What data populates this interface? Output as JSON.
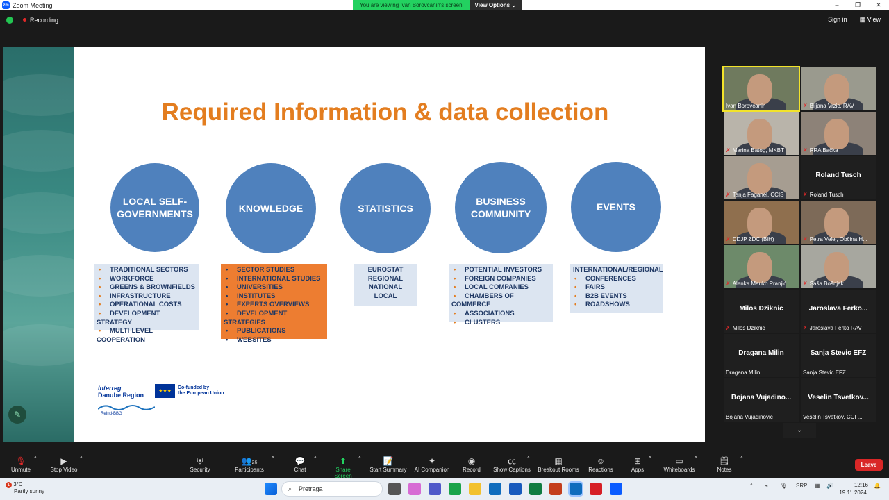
{
  "window": {
    "title": "Zoom Meeting"
  },
  "banner": {
    "message": "You are viewing Ivan Borovcanin's screen",
    "options_label": "View Options"
  },
  "window_controls": {
    "minimize": "–",
    "restore": "❐",
    "close": "✕"
  },
  "topbar": {
    "recording_label": "Recording",
    "sign_in": "Sign in",
    "view": "View"
  },
  "slide": {
    "title": "Required Information & data collection",
    "circles": [
      "LOCAL SELF-GOVERNMENTS",
      "KNOWLEDGE",
      "STATISTICS",
      "BUSINESS COMMUNITY",
      "EVENTS"
    ],
    "lists": {
      "local": [
        "TRADITIONAL SECTORS",
        "WORKFORCE",
        "GREENS & BROWNFIELDS",
        "INFRASTRUCTURE",
        "OPERATIONAL COSTS",
        "DEVELOPMENT STRATEGY",
        "MULTI-LEVEL COOPERATION"
      ],
      "knowledge": [
        "SECTOR STUDIES",
        "INTERNATIONAL STUDIES",
        "UNIVERSITIES",
        "INSTITUTES",
        "EXPERTS OVERVIEWS",
        "DEVELOPMENT STRATEGIES",
        "PUBLICATIONS",
        "WEBSITES"
      ],
      "statistics": [
        "EUROSTAT",
        "REGIONAL",
        "NATIONAL",
        "LOCAL"
      ],
      "business": [
        "POTENTIAL INVESTORS",
        "FOREIGN COMPANIES",
        "LOCAL COMPANIES",
        "CHAMBERS OF COMMERCE",
        "ASSOCIATIONS",
        "CLUSTERS"
      ],
      "events_heading": "INTERNATIONAL/REGIONAL",
      "events": [
        "CONFERENCES",
        "FAIRS",
        "B2B EVENTS",
        "ROADSHOWS"
      ]
    },
    "logos": {
      "interreg_1": "Interreg",
      "interreg_2": "Danube Region",
      "eu_1": "Co-funded by",
      "eu_2": "the European Union",
      "reind": "ReInd-BBG"
    }
  },
  "participants": [
    {
      "name": "Ivan Borovcanin",
      "video": true,
      "muted": false,
      "active": true,
      "color": "#6f7a5e"
    },
    {
      "name": "Biljana Vrzic, RAV",
      "video": true,
      "muted": true,
      "color": "#9a9a8e"
    },
    {
      "name": "Marina Batog, MKBT",
      "video": true,
      "muted": true,
      "color": "#b9b4aa"
    },
    {
      "name": "RRA Bačka",
      "video": true,
      "muted": true,
      "color": "#8d8278"
    },
    {
      "name": "Tanja Faganel, CCIS",
      "video": true,
      "muted": true,
      "color": "#a69d91"
    },
    {
      "name": "Roland Tusch",
      "video": false,
      "muted": true,
      "display": "Roland Tusch"
    },
    {
      "name": "DDJP ZDC (BiH)",
      "video": true,
      "muted": true,
      "color": "#8f6f4e"
    },
    {
      "name": "Petra Velej, Občina H...",
      "video": true,
      "muted": true,
      "color": "#7d6a58"
    },
    {
      "name": "Alenka Mauko Pranjić...",
      "video": true,
      "muted": true,
      "color": "#6d8a6a"
    },
    {
      "name": "Saša Bošnjak",
      "video": true,
      "muted": true,
      "color": "#a7a79f"
    },
    {
      "name": "Milos Dziknic",
      "video": false,
      "muted": true,
      "display": "Milos Dziknic"
    },
    {
      "name": "Jaroslava Ferko RAV",
      "video": false,
      "muted": true,
      "display": "Jaroslava  Ferko..."
    },
    {
      "name": "Dragana Milin",
      "video": false,
      "muted": false,
      "display": "Dragana Milin"
    },
    {
      "name": "Sanja Stevic EFZ",
      "video": false,
      "muted": false,
      "display": "Sanja Stevic EFZ"
    },
    {
      "name": "Bojana Vujadinovic",
      "video": false,
      "muted": false,
      "display": "Bojana  Vujadino..."
    },
    {
      "name": "Veselin Tsvetkov, CCI ...",
      "video": false,
      "muted": false,
      "display": "Veselin  Tsvetkov..."
    }
  ],
  "toolbar": {
    "unmute": "Unmute",
    "stop_video": "Stop Video",
    "security": "Security",
    "participants": "Participants",
    "participants_count": "26",
    "chat": "Chat",
    "share_screen": "Share Screen",
    "start_summary": "Start Summary",
    "ai_companion": "AI Companion",
    "record": "Record",
    "show_captions": "Show Captions",
    "breakout_rooms": "Breakout Rooms",
    "reactions": "Reactions",
    "apps": "Apps",
    "whiteboards": "Whiteboards",
    "notes": "Notes",
    "leave": "Leave"
  },
  "taskbar": {
    "weather_temp": "3°C",
    "weather_desc": "Partly sunny",
    "weather_badge": "1",
    "search_placeholder": "Pretraga",
    "language": "SRP",
    "time": "12:16",
    "date": "19.11.2024."
  }
}
